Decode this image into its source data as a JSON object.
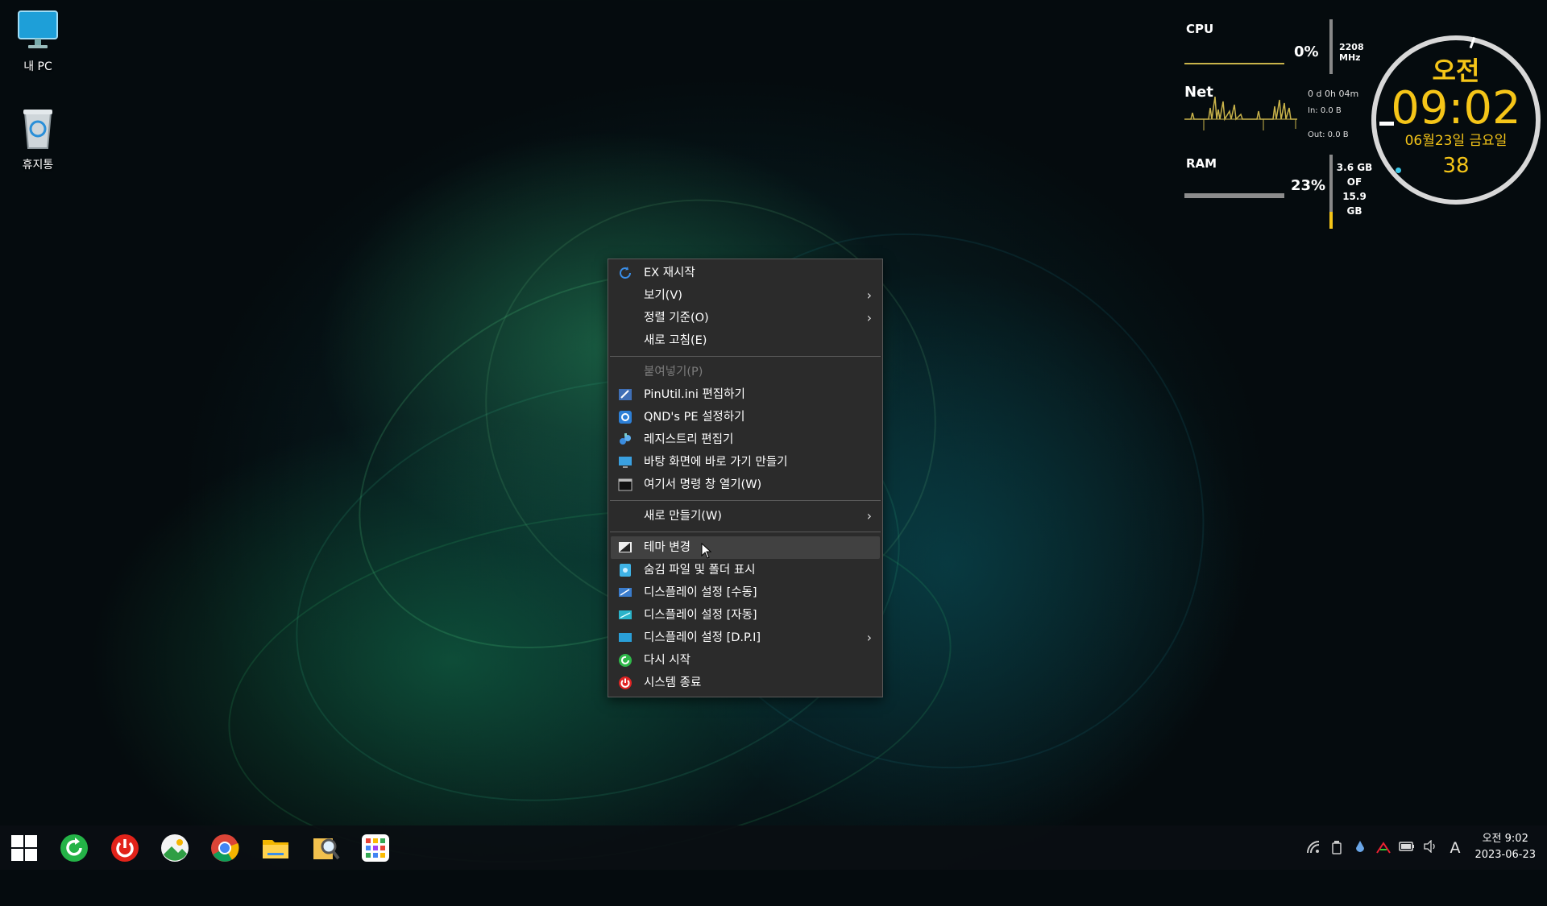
{
  "desktop": {
    "icons": [
      {
        "label": "내 PC"
      },
      {
        "label": "휴지통"
      }
    ]
  },
  "monitor": {
    "cpu": {
      "label": "CPU",
      "percent": "0%",
      "freq": "2208 MHz"
    },
    "net": {
      "label": "Net",
      "uptime": "0 d 0h 04m",
      "in": "In: 0.0 B",
      "out": "Out: 0.0 B"
    },
    "ram": {
      "label": "RAM",
      "percent": "23%",
      "used": "3.6 GB",
      "of": "OF",
      "total": "15.9 GB",
      "fill": 0.23
    }
  },
  "clock": {
    "ampm": "오전",
    "time": "09:02",
    "date": "06월23일 금요일",
    "seconds": "38"
  },
  "context_menu": {
    "items": [
      {
        "label": "EX 재시작",
        "icon": "refresh-icon"
      },
      {
        "label": "보기(V)",
        "submenu": true
      },
      {
        "label": "정렬 기준(O)",
        "submenu": true
      },
      {
        "label": "새로 고침(E)"
      },
      {
        "label": "붙여넣기(P)",
        "disabled": true
      },
      {
        "label": "PinUtil.ini 편집하기",
        "icon": "edit-icon"
      },
      {
        "label": "QND's PE 설정하기",
        "icon": "settings-icon"
      },
      {
        "label": "레지스트리 편집기",
        "icon": "registry-icon"
      },
      {
        "label": "바탕 화면에 바로 가기 만들기",
        "icon": "shortcut-icon"
      },
      {
        "label": "여기서 명령 창 열기(W)",
        "icon": "terminal-icon"
      },
      {
        "label": "새로 만들기(W)",
        "submenu": true
      },
      {
        "label": "테마 변경",
        "icon": "theme-icon"
      },
      {
        "label": "숨김 파일 및 폴더 표시",
        "icon": "hidden-files-icon"
      },
      {
        "label": "디스플레이 설정 [수동]",
        "icon": "display-icon"
      },
      {
        "label": "디스플레이 설정 [자동]",
        "icon": "display-auto-icon"
      },
      {
        "label": "디스플레이 설정 [D.P.I]",
        "icon": "display-dpi-icon",
        "submenu": true
      },
      {
        "label": "다시 시작",
        "icon": "restart-icon"
      },
      {
        "label": "시스템 종료",
        "icon": "power-icon"
      }
    ]
  },
  "taskbar": {
    "ime": "A",
    "time": "오전 9:02",
    "date": "2023-06-23"
  }
}
